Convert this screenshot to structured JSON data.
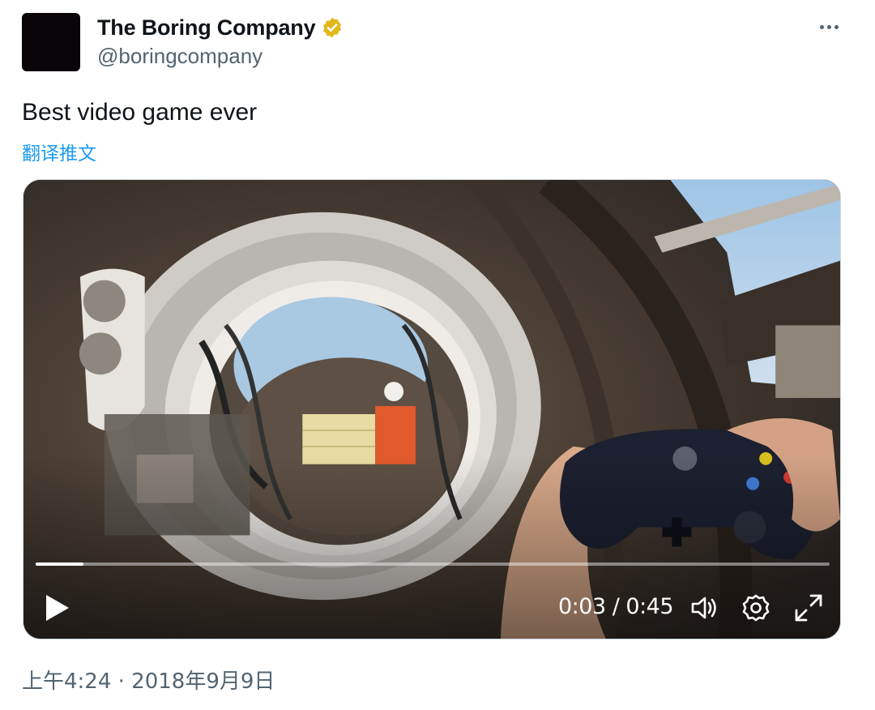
{
  "author": {
    "display_name": "The Boring Company",
    "handle": "@boringcompany",
    "verified_icon": "gold-verified-badge-icon",
    "avatar_color": "#0a0508"
  },
  "tweet": {
    "text": "Best video game ever",
    "translate_label": "翻译推文",
    "timestamp": "上午4:24 · 2018年9月9日"
  },
  "video": {
    "current_time": "0:03",
    "separator": " / ",
    "duration": "0:45",
    "progress_fraction": 0.06,
    "controls": [
      "play-icon",
      "volume-icon",
      "settings-gear-icon",
      "fullscreen-icon"
    ]
  },
  "colors": {
    "link": "#1d9bf0",
    "secondary_text": "#536471",
    "verified_gold": "#e2b719"
  }
}
